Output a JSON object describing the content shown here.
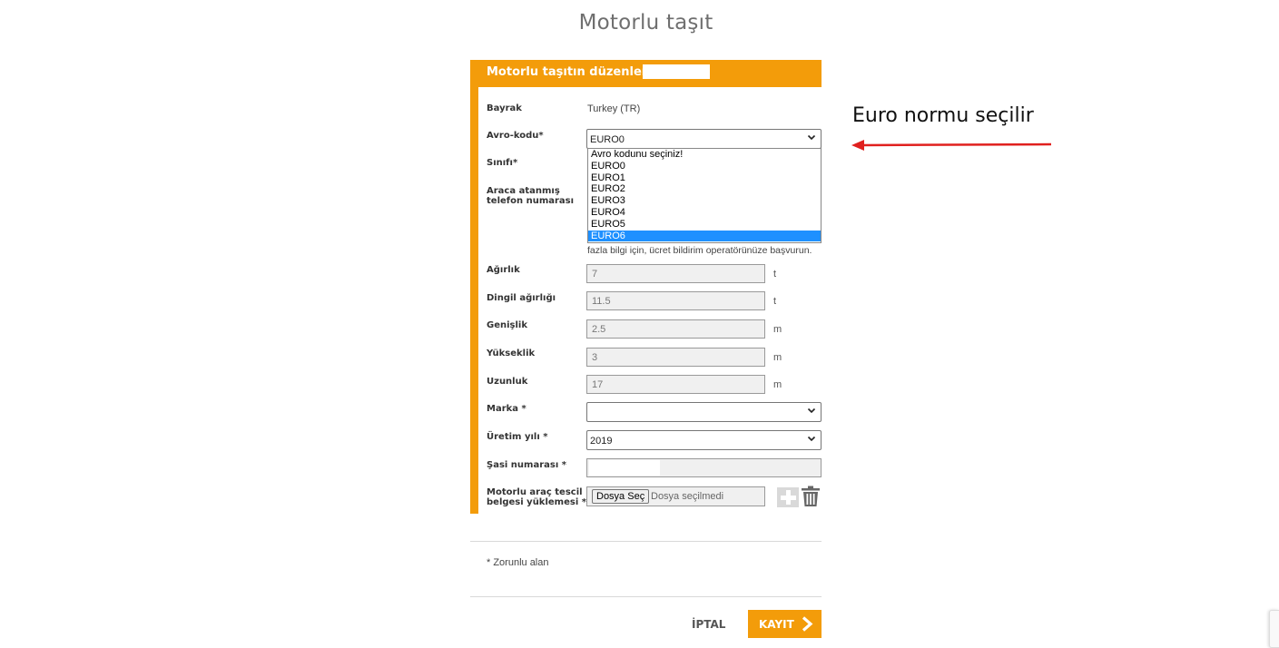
{
  "page_title": "Motorlu taşıt",
  "form": {
    "header": "Motorlu taşıtın düzenlenmesi -",
    "flag_label": "Bayrak",
    "flag_value": "Turkey (TR)",
    "euro_label": "Avro-kodu*",
    "euro_selected": "EURO0",
    "euro_options": [
      "Avro kodunu seçiniz!",
      "EURO0",
      "EURO1",
      "EURO2",
      "EURO3",
      "EURO4",
      "EURO5",
      "EURO6"
    ],
    "euro_highlighted": "EURO6",
    "class_label": "Sınıfı*",
    "phone_label": "Araca atanmış telefon numarası",
    "phone_hint": "fazla bilgi için, ücret bildirim operatörünüze başvurun.",
    "weight_label": "Ağırlık",
    "weight_value": "7",
    "weight_unit": "t",
    "axle_label": "Dingil ağırlığı",
    "axle_value": "11.5",
    "axle_unit": "t",
    "width_label": "Genişlik",
    "width_value": "2.5",
    "width_unit": "m",
    "height_label": "Yükseklik",
    "height_value": "3",
    "height_unit": "m",
    "length_label": "Uzunluk",
    "length_value": "17",
    "length_unit": "m",
    "brand_label": "Marka *",
    "brand_value": "",
    "year_label": "Üretim yılı *",
    "year_value": "2019",
    "chassis_label": "Şasi numarası *",
    "upload_label": "Motorlu araç tescil belgesi yüklemesi *",
    "file_button": "Dosya Seç",
    "file_status": "Dosya seçilmedi",
    "required_note": "* Zorunlu alan"
  },
  "actions": {
    "cancel": "İPTAL",
    "save": "KAYIT"
  },
  "annotation": {
    "text": "Euro normu seçilir",
    "arrow_color": "#e0201e"
  },
  "colors": {
    "accent": "#f39c0a",
    "highlight": "#1e90ff"
  }
}
